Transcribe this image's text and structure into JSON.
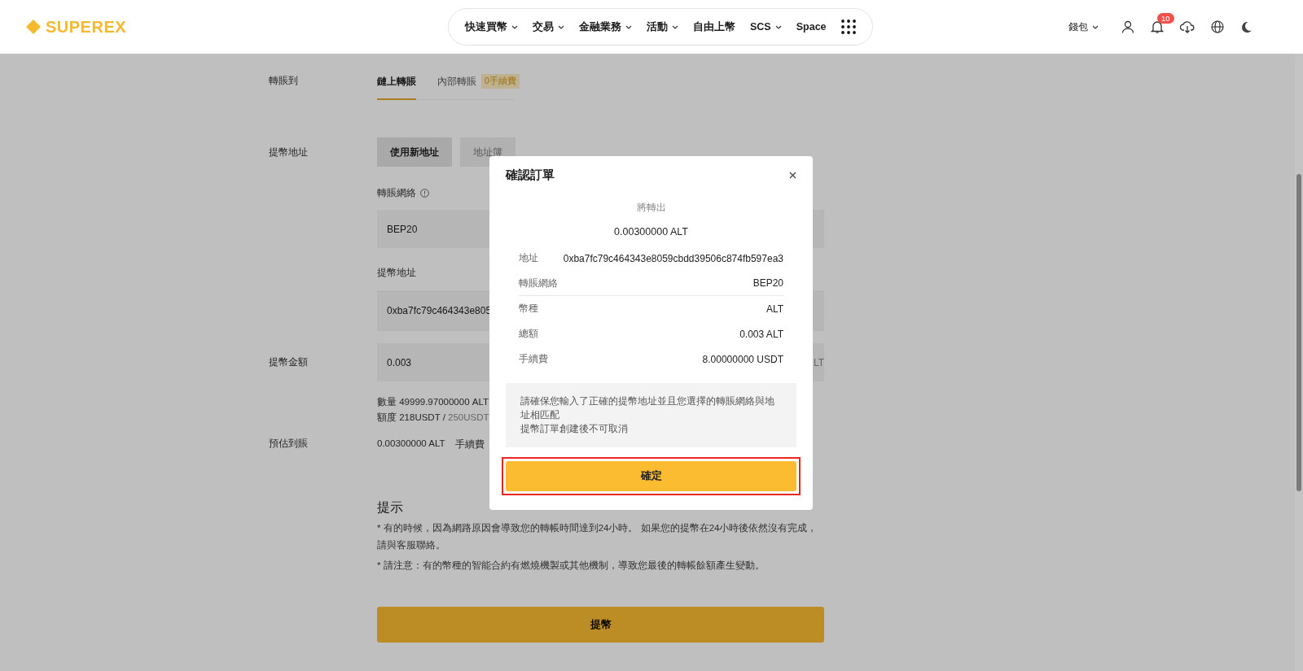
{
  "header": {
    "logo": "SUPEREX",
    "nav": [
      {
        "label": "快速買幣",
        "dropdown": true
      },
      {
        "label": "交易",
        "dropdown": true
      },
      {
        "label": "金融業務",
        "dropdown": true
      },
      {
        "label": "活動",
        "dropdown": true
      },
      {
        "label": "自由上幣",
        "dropdown": false
      },
      {
        "label": "SCS",
        "dropdown": true
      },
      {
        "label": "Space",
        "dropdown": false
      }
    ],
    "wallet": "錢包",
    "notification_count": "10"
  },
  "form": {
    "transfer_to": {
      "label": "轉賬到",
      "tabs": [
        {
          "label": "鏈上轉賬",
          "selected": true
        },
        {
          "label": "內部轉賬",
          "selected": false,
          "badge": "0手續費"
        }
      ]
    },
    "address_mode": {
      "label": "提幣地址",
      "options": [
        {
          "label": "使用新地址",
          "selected": true
        },
        {
          "label": "地址簿",
          "selected": false
        }
      ]
    },
    "network": {
      "label": "轉賬網絡",
      "value": "BEP20"
    },
    "address": {
      "label": "提幣地址",
      "value": "0xba7fc79c464343e805"
    },
    "amount": {
      "label": "提幣金額",
      "value": "0.003",
      "unit": "LT"
    },
    "quantity": "數量 49999.97000000 ALT",
    "quota": {
      "used": "額度 218USDT /",
      "limit": "250USDT"
    },
    "estimate": {
      "label": "預估到賬",
      "value": "0.00300000 ALT",
      "fee_label": "手續費"
    },
    "tips": {
      "title": "提示",
      "notes": [
        "* 有的時候，因為網路原因會導致您的轉帳時間達到24小時。 如果您的提幣在24小時後依然沒有完成，請與客服聯絡。",
        "* 請注意：有的幣種的智能合約有燃燒機製或其他機制，導致您最後的轉帳餘額產生變動。"
      ]
    },
    "submit": "提幣"
  },
  "dialog": {
    "title": "確認訂單",
    "subtitle": "將轉出",
    "amount": "0.00300000 ALT",
    "rows": [
      {
        "label": "地址",
        "value": "0xba7fc79c464343e8059cbdd39506c874fb597ea3",
        "divider_after": false
      },
      {
        "label": "轉賬網絡",
        "value": "BEP20",
        "divider_after": true
      },
      {
        "label": "幣種",
        "value": "ALT",
        "divider_after": false
      },
      {
        "label": "總額",
        "value": "0.003 ALT",
        "divider_after": false
      },
      {
        "label": "手續費",
        "value": "8.00000000 USDT",
        "divider_after": false
      }
    ],
    "notice": [
      "請確保您輸入了正確的提幣地址並且您選擇的轉賬網絡與地址相匹配",
      "提幣訂單創建後不可取消"
    ],
    "confirm": "確定",
    "highlighted": true
  }
}
